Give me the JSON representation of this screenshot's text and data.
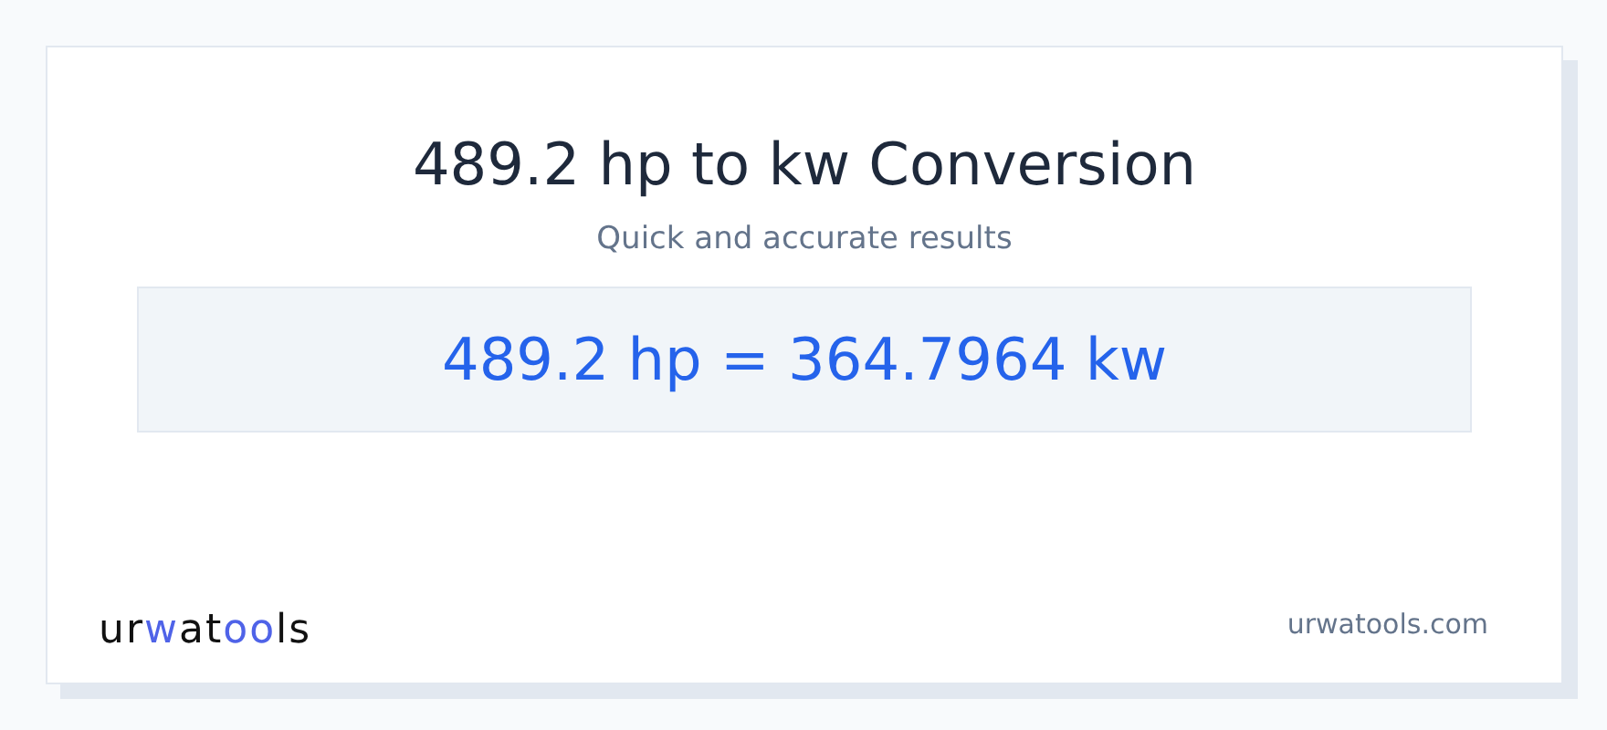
{
  "title": "489.2 hp to kw Conversion",
  "subtitle": "Quick and accurate results",
  "result": "489.2 hp = 364.7964 kw",
  "logo": [
    {
      "text": "ur",
      "accent": false
    },
    {
      "text": "w",
      "accent": true
    },
    {
      "text": "at",
      "accent": false
    },
    {
      "text": "oo",
      "accent": true
    },
    {
      "text": "ls",
      "accent": false
    }
  ],
  "site": "urwatools.com"
}
